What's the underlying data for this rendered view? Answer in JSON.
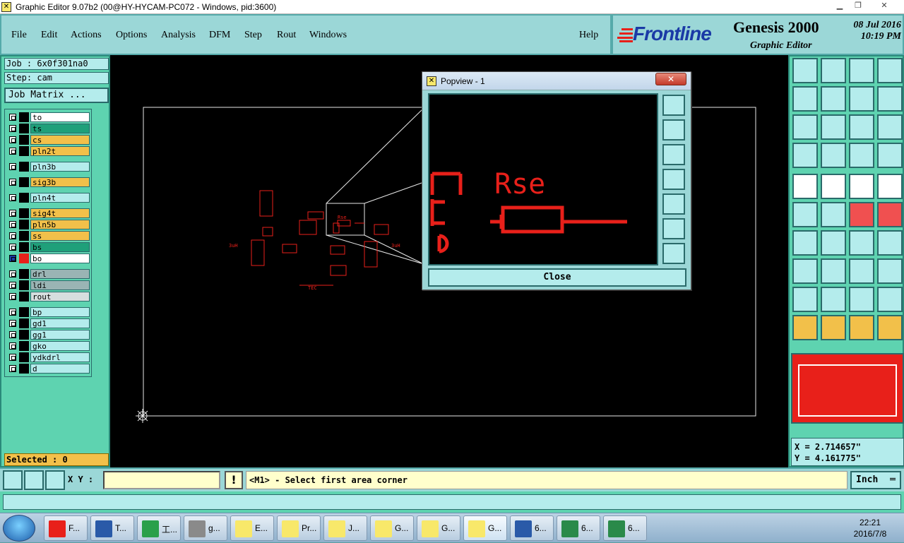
{
  "window": {
    "title": "Graphic Editor 9.07b2 (00@HY-HYCAM-PC072 - Windows, pid:3600)"
  },
  "menu": {
    "items": [
      "File",
      "Edit",
      "Actions",
      "Options",
      "Analysis",
      "DFM",
      "Step",
      "Rout",
      "Windows"
    ],
    "help": "Help"
  },
  "brand": {
    "logo": "Frontline",
    "product": "Genesis 2000",
    "subtitle": "Graphic Editor",
    "date": "08 Jul 2016",
    "time": "10:19 PM"
  },
  "job": {
    "job_label": "Job : 6x0f301na0",
    "step_label": "Step: cam",
    "matrix_button": "Job Matrix ..."
  },
  "layers": [
    {
      "name": "to",
      "color": "#ffffff",
      "group": 1
    },
    {
      "name": "ts",
      "color": "#1fa07a",
      "group": 1
    },
    {
      "name": "cs",
      "color": "#f2c04a",
      "group": 1
    },
    {
      "name": "pln2t",
      "color": "#f2c04a",
      "group": 1
    },
    {
      "name": "pln3b",
      "color": "#b4ecec",
      "group": 2
    },
    {
      "name": "sig3b",
      "color": "#f2c04a",
      "group": 3
    },
    {
      "name": "pln4t",
      "color": "#b4ecec",
      "group": 4
    },
    {
      "name": "sig4t",
      "color": "#f2c04a",
      "group": 5
    },
    {
      "name": "pln5b",
      "color": "#f2c04a",
      "group": 5
    },
    {
      "name": "ss",
      "color": "#f2c04a",
      "group": 5
    },
    {
      "name": "bs",
      "color": "#1fa07a",
      "group": 5
    },
    {
      "name": "bo",
      "color": "#ffffff",
      "group": 5,
      "active": true
    },
    {
      "name": "drl",
      "color": "#9ab4b4",
      "group": 6
    },
    {
      "name": "ldi",
      "color": "#9ab4b4",
      "group": 6
    },
    {
      "name": "rout",
      "color": "#d6dede",
      "group": 6
    },
    {
      "name": "bp",
      "color": "#b4ecec",
      "group": 7
    },
    {
      "name": "gd1",
      "color": "#b4ecec",
      "group": 7
    },
    {
      "name": "gg1",
      "color": "#b4ecec",
      "group": 7
    },
    {
      "name": "gko",
      "color": "#b4ecec",
      "group": 7
    },
    {
      "name": "ydkdrl",
      "color": "#b4ecec",
      "group": 7
    },
    {
      "name": "d",
      "color": "#b4ecec",
      "group": 7
    }
  ],
  "selected": "Selected : 0",
  "canvas": {
    "label": "Rse"
  },
  "popview": {
    "title": "Popview - 1",
    "close_button": "Close",
    "label_large": "Rse"
  },
  "coords": {
    "x": "X = 2.714657\"",
    "y": "Y = 4.161775\""
  },
  "command": {
    "xy_label": "X Y :",
    "xy_value": "",
    "prompt": "<M1> - Select first area corner",
    "units": "Inch"
  },
  "taskbar": {
    "tasks": [
      "F...",
      "T...",
      "工...",
      "g...",
      "E...",
      "Pr...",
      "J...",
      "G...",
      "G...",
      "G...",
      "6...",
      "6...",
      "6..."
    ],
    "clock_time": "22:21",
    "clock_date": "2016/7/8"
  },
  "colors": {
    "accent": "#5ed3b0",
    "panel": "#9bd7d7",
    "trace": "#e8201a",
    "prompt_bg": "#ffffcc"
  }
}
